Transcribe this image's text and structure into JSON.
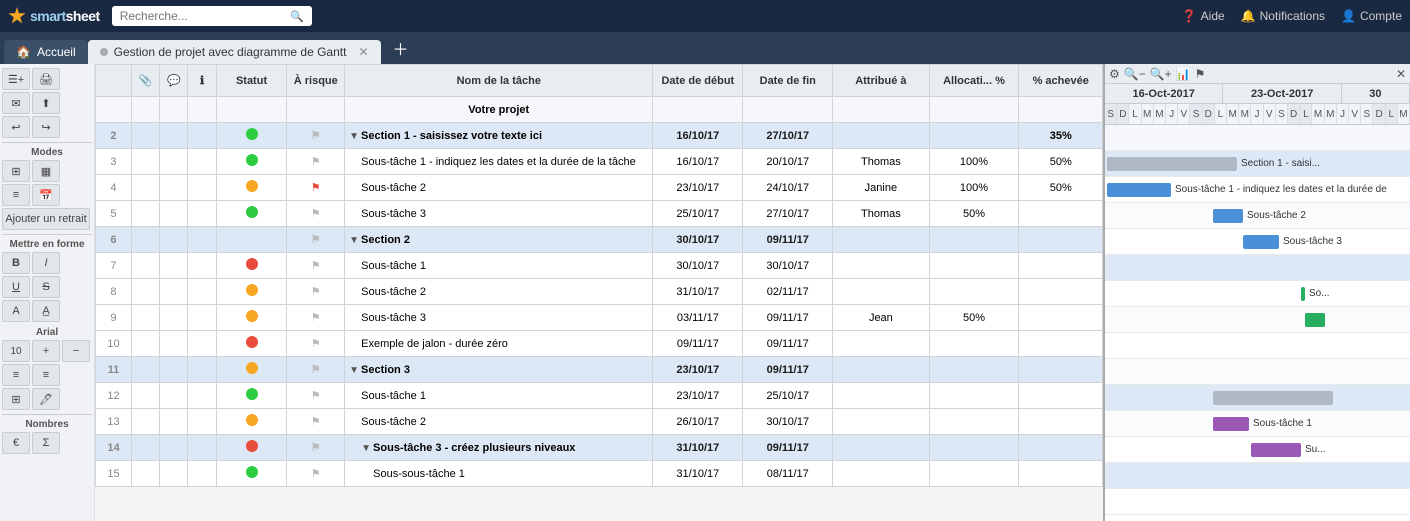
{
  "app": {
    "name": "smart",
    "name_bold": "sheet",
    "search_placeholder": "Recherche..."
  },
  "nav": {
    "help": "Aide",
    "notifications": "Notifications",
    "account": "Compte"
  },
  "tabs": {
    "home": "Accueil",
    "sheet_title": "Gestion de projet avec diagramme de Gantt"
  },
  "columns": {
    "statut": "Statut",
    "a_risque": "À risque",
    "nom_tache": "Nom de la tâche",
    "date_debut": "Date de début",
    "date_fin": "Date de fin",
    "attribue_a": "Attribué à",
    "allocation": "Allocati... %",
    "pct_achevee": "% achevée"
  },
  "rows": [
    {
      "num": "",
      "type": "header",
      "task": "Votre projet",
      "start": "",
      "end": "",
      "assigned": "",
      "alloc": "",
      "pct": ""
    },
    {
      "num": "2",
      "type": "section",
      "status": "green",
      "flag": false,
      "task": "Section 1 - saisissez votre texte ici",
      "start": "16/10/17",
      "end": "27/10/17",
      "assigned": "",
      "alloc": "",
      "pct": "35%",
      "indent": 1
    },
    {
      "num": "3",
      "type": "task",
      "status": "green",
      "flag": false,
      "task": "Sous-tâche 1 - indiquez les dates et la durée de la tâche",
      "start": "16/10/17",
      "end": "20/10/17",
      "assigned": "Thomas",
      "alloc": "100%",
      "pct": "50%",
      "indent": 2
    },
    {
      "num": "4",
      "type": "task",
      "status": "yellow",
      "flag": true,
      "task": "Sous-tâche 2",
      "start": "23/10/17",
      "end": "24/10/17",
      "assigned": "Janine",
      "alloc": "100%",
      "pct": "50%",
      "indent": 2
    },
    {
      "num": "5",
      "type": "task",
      "status": "green",
      "flag": false,
      "task": "Sous-tâche 3",
      "start": "25/10/17",
      "end": "27/10/17",
      "assigned": "Thomas",
      "alloc": "50%",
      "pct": "",
      "indent": 2
    },
    {
      "num": "6",
      "type": "section",
      "status": null,
      "flag": false,
      "task": "Section 2",
      "start": "30/10/17",
      "end": "09/11/17",
      "assigned": "",
      "alloc": "",
      "pct": "",
      "indent": 1
    },
    {
      "num": "7",
      "type": "task",
      "status": "red",
      "flag": false,
      "task": "Sous-tâche 1",
      "start": "30/10/17",
      "end": "30/10/17",
      "assigned": "",
      "alloc": "",
      "pct": "",
      "indent": 2
    },
    {
      "num": "8",
      "type": "task",
      "status": "yellow",
      "flag": false,
      "task": "Sous-tâche 2",
      "start": "31/10/17",
      "end": "02/11/17",
      "assigned": "",
      "alloc": "",
      "pct": "",
      "indent": 2
    },
    {
      "num": "9",
      "type": "task",
      "status": "yellow",
      "flag": false,
      "task": "Sous-tâche 3",
      "start": "03/11/17",
      "end": "09/11/17",
      "assigned": "Jean",
      "alloc": "50%",
      "pct": "",
      "indent": 2
    },
    {
      "num": "10",
      "type": "task",
      "status": "red",
      "flag": false,
      "task": "Exemple de jalon - durée zéro",
      "start": "09/11/17",
      "end": "09/11/17",
      "assigned": "",
      "alloc": "",
      "pct": "",
      "indent": 2
    },
    {
      "num": "11",
      "type": "section",
      "status": "yellow",
      "flag": false,
      "task": "Section 3",
      "start": "23/10/17",
      "end": "09/11/17",
      "assigned": "",
      "alloc": "",
      "pct": "",
      "indent": 1
    },
    {
      "num": "12",
      "type": "task",
      "status": "green",
      "flag": false,
      "task": "Sous-tâche 1",
      "start": "23/10/17",
      "end": "25/10/17",
      "assigned": "",
      "alloc": "",
      "pct": "",
      "indent": 2
    },
    {
      "num": "13",
      "type": "task",
      "status": "yellow",
      "flag": false,
      "task": "Sous-tâche 2",
      "start": "26/10/17",
      "end": "30/10/17",
      "assigned": "",
      "alloc": "",
      "pct": "",
      "indent": 2
    },
    {
      "num": "14",
      "type": "section",
      "status": "red",
      "flag": false,
      "task": "Sous-tâche 3 - créez plusieurs niveaux",
      "start": "31/10/17",
      "end": "09/11/17",
      "assigned": "",
      "alloc": "",
      "pct": "",
      "indent": 2
    },
    {
      "num": "15",
      "type": "task",
      "status": "green",
      "flag": false,
      "task": "Sous-sous-tâche 1",
      "start": "31/10/17",
      "end": "08/11/17",
      "assigned": "",
      "alloc": "",
      "pct": "",
      "indent": 3
    }
  ],
  "gantt": {
    "weeks": [
      "16-Oct-2017",
      "23-Oct-2017",
      "30"
    ],
    "days": [
      "S",
      "D",
      "L",
      "M",
      "M",
      "J",
      "V",
      "S",
      "D",
      "L",
      "M",
      "M",
      "J",
      "V",
      "S",
      "D",
      "L",
      "M",
      "M",
      "J",
      "V",
      "S",
      "D",
      "L",
      "M"
    ]
  },
  "sidebar": {
    "modes_label": "Modes",
    "ajouter_retrait": "Ajouter un retrait",
    "mettre_forme": "Mettre en forme",
    "font_name": "Arial",
    "font_size": "10",
    "nombres_label": "Nombres"
  }
}
